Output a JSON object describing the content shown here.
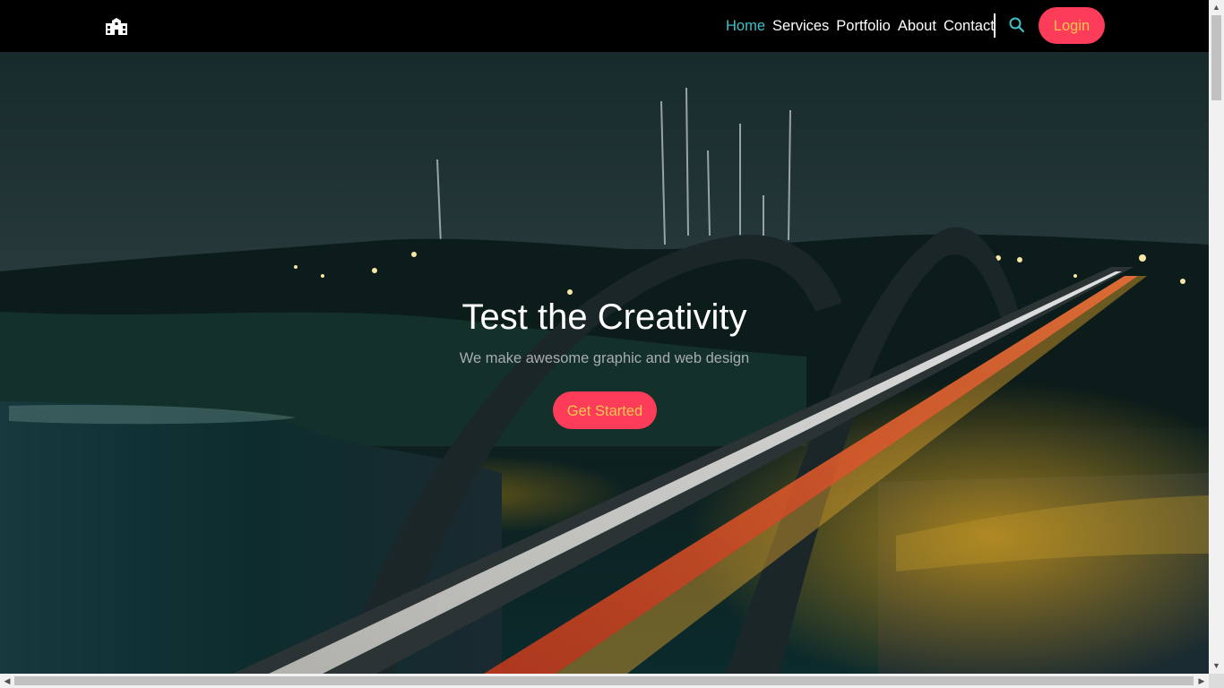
{
  "header": {
    "logo_icon": "building-icon",
    "nav": [
      {
        "label": "Home",
        "active": true
      },
      {
        "label": "Services",
        "active": false
      },
      {
        "label": "Portfolio",
        "active": false
      },
      {
        "label": "About",
        "active": false
      },
      {
        "label": "Contact",
        "active": false
      }
    ],
    "search_icon": "search-icon",
    "login_label": "Login"
  },
  "hero": {
    "title": "Test the Creativity",
    "subtitle": "We make awesome graphic and web design",
    "cta_label": "Get Started"
  },
  "colors": {
    "accent_active": "#3fc1c9",
    "button_bg": "#fc3c58",
    "button_text": "#f9c74f",
    "navbar_bg": "#000000"
  }
}
